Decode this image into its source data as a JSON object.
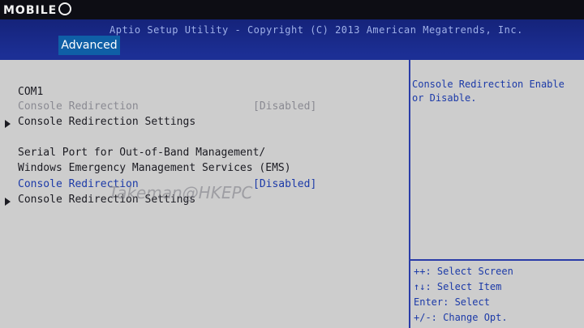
{
  "watermark": {
    "logo_text": "MOBILE",
    "credit": "Takeman@HKEPC"
  },
  "header": {
    "title": "Aptio Setup Utility - Copyright (C) 2013 American Megatrends, Inc.",
    "active_tab": "Advanced"
  },
  "content": {
    "com1_heading": "COM1",
    "com1_redirection": {
      "label": "Console Redirection",
      "value": "[Disabled]"
    },
    "com1_settings": "Console Redirection Settings",
    "sp_heading_line1": "Serial Port for Out-of-Band Management/",
    "sp_heading_line2": "Windows Emergency Management Services (EMS)",
    "sp_redirection": {
      "label": "Console Redirection",
      "value": "[Disabled]"
    },
    "sp_settings": "Console Redirection Settings"
  },
  "help": {
    "text": "Console Redirection Enable or Disable.",
    "keys": [
      "++: Select Screen",
      "↑↓: Select Item",
      "Enter: Select",
      "+/-: Change Opt."
    ]
  }
}
